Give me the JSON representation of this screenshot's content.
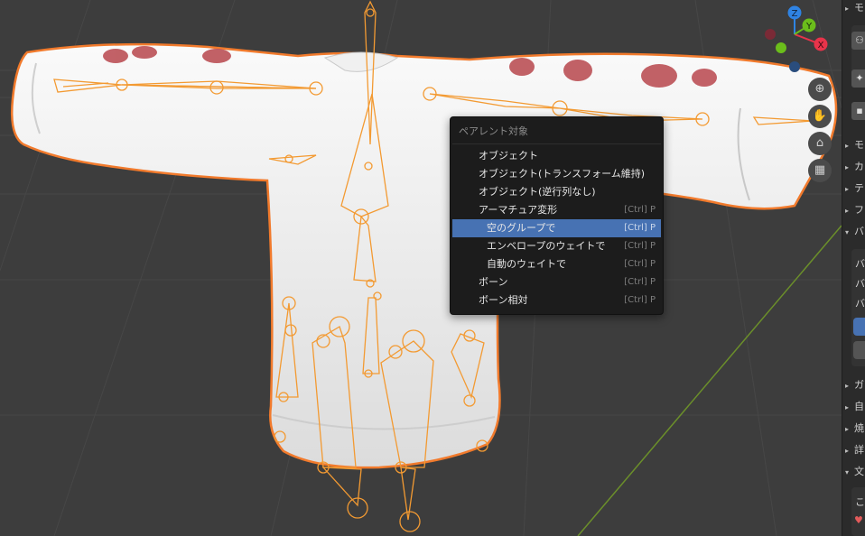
{
  "menu": {
    "title": "ペアレント対象",
    "items": [
      {
        "label": "オブジェクト",
        "shortcut": ""
      },
      {
        "label": "オブジェクト(トランスフォーム維持)",
        "shortcut": ""
      },
      {
        "label": "オブジェクト(逆行列なし)",
        "shortcut": ""
      },
      {
        "label": "アーマチュア変形",
        "shortcut": "[Ctrl] P"
      },
      {
        "label": "空のグループで",
        "shortcut": "[Ctrl] P"
      },
      {
        "label": "エンベロープのウェイトで",
        "shortcut": "[Ctrl] P"
      },
      {
        "label": "自動のウェイトで",
        "shortcut": "[Ctrl] P"
      },
      {
        "label": "ボーン",
        "shortcut": "[Ctrl] P"
      },
      {
        "label": "ボーン相対",
        "shortcut": "[Ctrl] P"
      }
    ],
    "selected_index": 4
  },
  "gizmo": {
    "x": "X",
    "y": "Y",
    "z": "Z"
  },
  "nav": [
    "zoom-icon",
    "hand-icon",
    "camera-icon",
    "grid-icon"
  ],
  "props": {
    "rows": [
      {
        "arrow": "▸",
        "text": "モ"
      },
      {
        "arrow": "▸",
        "text": "カ"
      },
      {
        "arrow": "▸",
        "text": "テ"
      },
      {
        "arrow": "▸",
        "text": "フ"
      },
      {
        "arrow": "▾",
        "text": "バ"
      },
      {
        "arrow": "",
        "text": "バ"
      },
      {
        "arrow": "",
        "text": "バ"
      },
      {
        "arrow": "",
        "text": "バ"
      },
      {
        "arrow": "▸",
        "text": "ガ"
      },
      {
        "arrow": "▸",
        "text": "自"
      },
      {
        "arrow": "▸",
        "text": "焼"
      },
      {
        "arrow": "▸",
        "text": "詳"
      },
      {
        "arrow": "▾",
        "text": "文"
      },
      {
        "arrow": "",
        "text": "こ"
      }
    ]
  },
  "colors": {
    "accent": "#4772b3",
    "selection_outline": "#f17a2c",
    "bone": "#f39a32",
    "axis_x": "#e8334a",
    "axis_y": "#6bbe1b",
    "axis_z": "#2f83e3"
  }
}
